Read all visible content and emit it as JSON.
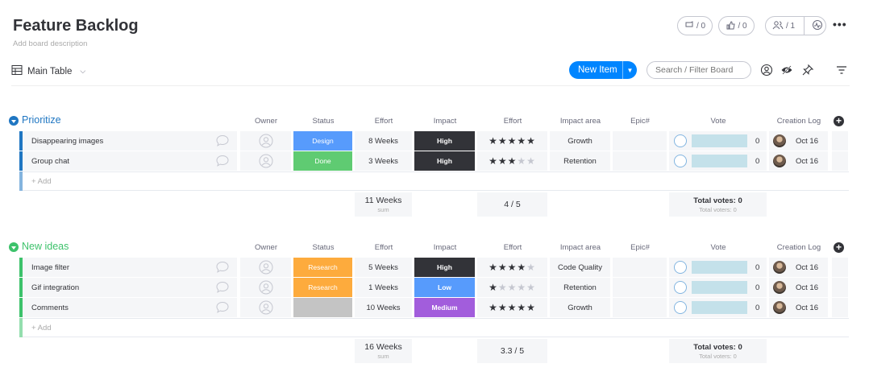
{
  "board": {
    "title": "Feature Backlog",
    "description": "Add board description"
  },
  "header": {
    "updates_count": "/ 0",
    "likes_count": "/ 0",
    "members_count": "/ 1",
    "more": "•••"
  },
  "toolbar": {
    "view_label": "Main Table",
    "new_item_label": "New Item",
    "search_placeholder": "Search / Filter Board"
  },
  "columns": [
    "Owner",
    "Status",
    "Effort",
    "Impact",
    "Effort",
    "Impact area",
    "Epic#",
    "Vote",
    "Creation Log"
  ],
  "colors": {
    "status_design": "#579bfc",
    "status_done": "#5fcb72",
    "status_research": "#fdab3d",
    "status_empty": "#c4c4c4",
    "impact_high": "#323338",
    "impact_low": "#579bfc",
    "impact_medium": "#a25ddc",
    "group_prioritize": "#0086c0",
    "group_new_ideas": "#3dc26b",
    "primary": "#0085ff"
  },
  "groups": [
    {
      "title": "Prioritize",
      "color": "#1f76c2",
      "add_label": "+ Add",
      "rows": [
        {
          "name": "Disappearing images",
          "status": "Design",
          "status_color": "#579bfc",
          "effort": "8 Weeks",
          "impact": "High",
          "impact_color": "#323338",
          "stars": 5,
          "impact_area": "Growth",
          "epic": "",
          "votes": "0",
          "created": "Oct 16"
        },
        {
          "name": "Group chat",
          "status": "Done",
          "status_color": "#5fcb72",
          "effort": "3 Weeks",
          "impact": "High",
          "impact_color": "#323338",
          "stars": 3,
          "impact_area": "Retention",
          "epic": "",
          "votes": "0",
          "created": "Oct 16"
        }
      ],
      "summary": {
        "effort_total": "11 Weeks",
        "effort_label": "sum",
        "rating": "4 / 5",
        "votes_total": "Total votes: 0",
        "voters_total": "Total voters: 0"
      }
    },
    {
      "title": "New ideas",
      "color": "#3dc26b",
      "add_label": "+ Add",
      "rows": [
        {
          "name": "Image filter",
          "status": "Research",
          "status_color": "#fdab3d",
          "effort": "5 Weeks",
          "impact": "High",
          "impact_color": "#323338",
          "stars": 4,
          "impact_area": "Code Quality",
          "epic": "",
          "votes": "0",
          "created": "Oct 16"
        },
        {
          "name": "Gif integration",
          "status": "Research",
          "status_color": "#fdab3d",
          "effort": "1 Weeks",
          "impact": "Low",
          "impact_color": "#579bfc",
          "stars": 1,
          "impact_area": "Retention",
          "epic": "",
          "votes": "0",
          "created": "Oct 16"
        },
        {
          "name": "Comments",
          "status": "",
          "status_color": "#c4c4c4",
          "effort": "10 Weeks",
          "impact": "Medium",
          "impact_color": "#a25ddc",
          "stars": 5,
          "impact_area": "Growth",
          "epic": "",
          "votes": "0",
          "created": "Oct 16"
        }
      ],
      "summary": {
        "effort_total": "16 Weeks",
        "effort_label": "sum",
        "rating": "3.3 / 5",
        "votes_total": "Total votes: 0",
        "voters_total": "Total voters: 0"
      }
    }
  ]
}
